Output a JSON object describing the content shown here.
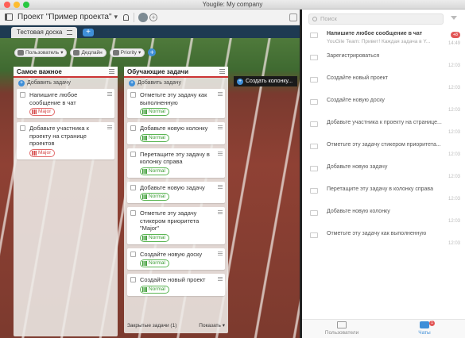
{
  "window": {
    "title": "Yougile: My company"
  },
  "header": {
    "project": "Проект \"Пример проекта\"",
    "chevron": "▾"
  },
  "tabs": [
    {
      "label": "Тестовая доска"
    }
  ],
  "filters": [
    {
      "label": "Пользователь"
    },
    {
      "label": "Дедлайн"
    },
    {
      "label": "Priority"
    }
  ],
  "columns": [
    {
      "title": "Самое важное",
      "add_label": "Добавить задачу",
      "cards": [
        {
          "text": "Напишите любое сообщение в чат",
          "tag": "Major"
        },
        {
          "text": "Добавьте участника к проекту на странице проектов",
          "tag": "Major"
        }
      ]
    },
    {
      "title": "Обучающие задачи",
      "add_label": "Добавить задачу",
      "cards": [
        {
          "text": "Отметьте эту задачу как выполненную",
          "tag": "Normal"
        },
        {
          "text": "Добавьте новую колонку",
          "tag": "Normal"
        },
        {
          "text": "Перетащите эту задачу в колонку справа",
          "tag": "Normal"
        },
        {
          "text": "Добавьте новую задачу",
          "tag": "Normal"
        },
        {
          "text": "Отметьте эту задачу стикером приоритета \"Major\"",
          "tag": "Normal"
        },
        {
          "text": "Создайте новую доску",
          "tag": "Normal"
        },
        {
          "text": "Создайте новый проект",
          "tag": "Normal"
        }
      ],
      "closed_label": "Закрытые задачи (1)",
      "show_label": "Показать"
    }
  ],
  "new_column_label": "Создать колонку...",
  "chat": {
    "search_placeholder": "Поиск",
    "messages": [
      {
        "title": "Напишите любое сообщение в чат",
        "sub": "YouGile Team: Привет! Каждая задача в Y...",
        "time": "14:49",
        "badge": "+8"
      },
      {
        "title": "Зарегистрироваться",
        "time": "12:03"
      },
      {
        "title": "Создайте новый проект",
        "time": "12:03"
      },
      {
        "title": "Создайте новую доску",
        "time": "12:03"
      },
      {
        "title": "Добавьте участника к проекту на странице...",
        "time": "12:03"
      },
      {
        "title": "Отметьте эту задачу стикером приоритета...",
        "time": "12:03"
      },
      {
        "title": "Добавьте новую задачу",
        "time": "12:03"
      },
      {
        "title": "Перетащите эту задачу в колонку справа",
        "time": "12:03"
      },
      {
        "title": "Добавьте новую колонку",
        "time": "12:03"
      },
      {
        "title": "Отметьте эту задачу как выполненную",
        "time": "12:03"
      }
    ],
    "nav": {
      "users": "Пользователи",
      "chats": "Чаты",
      "chats_badge": "1"
    }
  }
}
